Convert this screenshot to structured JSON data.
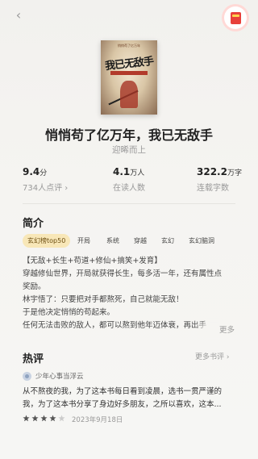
{
  "header": {
    "back_icon": "chevron-left-icon",
    "redpacket_icon": "red-packet-icon"
  },
  "book": {
    "cover_text": {
      "top": "悄悄苟了亿万年",
      "title": "我已无敌手"
    },
    "title": "悄悄苟了亿万年，我已无敌手",
    "author": "迎晞而上"
  },
  "stats": [
    {
      "value": "9.4",
      "unit": "分",
      "label": "734人点评 ›"
    },
    {
      "value": "4.1",
      "unit": "万人",
      "label": "在读人数"
    },
    {
      "value": "322.2",
      "unit": "万字",
      "label": "连载字数"
    }
  ],
  "intro": {
    "heading": "简介",
    "tags": [
      "玄幻榜top50",
      "开局",
      "系统",
      "穿越",
      "玄幻",
      "玄幻脑洞"
    ],
    "lines": [
      "【无敌+长生+苟道+修仙+搞笑+发育】",
      "穿越修仙世界，开局就获得长生，每多活一年，还有属性点",
      "奖励。",
      "林宇悟了：只要把对手都熬死，自己就能无敌！",
      "于是他决定悄悄的苟起来。",
      "任何无法击败的敌人，都可以熬到他年迈体衰，再出手"
    ],
    "more": "更多"
  },
  "reviews": {
    "heading": "热评",
    "more": "更多书评 ›",
    "items": [
      {
        "user": "少年心事当浮云",
        "lines": [
          "从不熬夜的我，为了这本书每日看到凌晨，选书一贯严谨的",
          "我，为了这本书分享了身边好多朋友，之所以喜欢，这本..."
        ],
        "rating": 4,
        "date": "2023年9月18日"
      }
    ]
  }
}
